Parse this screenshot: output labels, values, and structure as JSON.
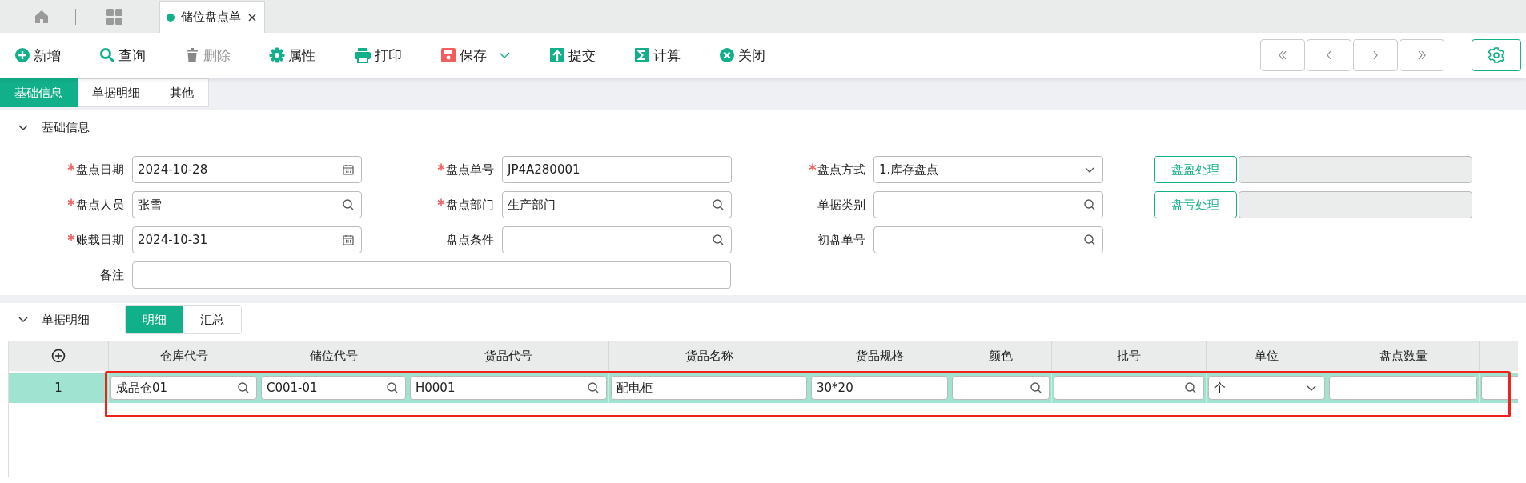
{
  "doc_tabs": [
    {
      "label": "储位盘点单",
      "selected": true,
      "closable": true
    }
  ],
  "toolbar": [
    {
      "kind": "add",
      "label": "新增",
      "disabled": false
    },
    {
      "kind": "search",
      "label": "查询",
      "disabled": false
    },
    {
      "kind": "delete",
      "label": "删除",
      "disabled": true
    },
    {
      "kind": "props",
      "label": "属性",
      "disabled": false
    },
    {
      "kind": "print",
      "label": "打印",
      "disabled": false
    },
    {
      "kind": "save",
      "label": "保存",
      "disabled": false,
      "has_menu": true
    },
    {
      "kind": "submit",
      "label": "提交",
      "disabled": false
    },
    {
      "kind": "calc",
      "label": "计算",
      "disabled": false
    },
    {
      "kind": "close",
      "label": "关闭",
      "disabled": false
    }
  ],
  "form_tabs": [
    {
      "label": "基础信息",
      "selected": true
    },
    {
      "label": "单据明细",
      "selected": false
    },
    {
      "label": "其他",
      "selected": false
    }
  ],
  "basic_section": {
    "title": "基础信息",
    "expanded": true,
    "rows": [
      [
        {
          "kind": "date",
          "label": "盘点日期",
          "required": true,
          "value": "2024-10-28"
        },
        {
          "kind": "text",
          "label": "盘点单号",
          "required": true,
          "value": "JP4A280001"
        },
        {
          "kind": "select",
          "label": "盘点方式",
          "required": true,
          "value": "1.库存盘点"
        },
        {
          "kind": "action",
          "label": "盘盈处理"
        }
      ],
      [
        {
          "kind": "lookup",
          "label": "盘点人员",
          "required": true,
          "value": "张雪"
        },
        {
          "kind": "lookup",
          "label": "盘点部门",
          "required": true,
          "value": "生产部门"
        },
        {
          "kind": "lookup",
          "label": "单据类别",
          "required": false
        },
        {
          "kind": "action",
          "label": "盘亏处理"
        }
      ],
      [
        {
          "kind": "date",
          "label": "账载日期",
          "required": true,
          "value": "2024-10-31"
        },
        {
          "kind": "lookup",
          "label": "盘点条件",
          "required": false
        },
        {
          "kind": "lookup",
          "label": "初盘单号",
          "required": false
        }
      ],
      [
        {
          "kind": "wide",
          "label": "备注",
          "required": false
        }
      ]
    ]
  },
  "detail_section": {
    "title": "单据明细",
    "expanded": true,
    "views": [
      {
        "label": "明细",
        "selected": true
      },
      {
        "label": "汇总",
        "selected": false
      }
    ]
  },
  "table": {
    "columns": [
      {
        "label": "仓库代号"
      },
      {
        "label": "储位代号"
      },
      {
        "label": "货品代号"
      },
      {
        "label": "货品名称"
      },
      {
        "label": "货品规格"
      },
      {
        "label": "颜色"
      },
      {
        "label": "批号"
      },
      {
        "label": "单位"
      },
      {
        "label": "盘点数量"
      },
      {
        "cut": true
      }
    ],
    "rows": [
      {
        "number": "1",
        "selected": true,
        "highlighted": true,
        "cells": [
          {
            "kind": "lookup",
            "value": "成品仓01"
          },
          {
            "kind": "lookup",
            "value": "C001-01"
          },
          {
            "kind": "lookup",
            "value": "H0001"
          },
          {
            "kind": "text",
            "value": "配电柜"
          },
          {
            "kind": "text",
            "value": "30*20"
          },
          {
            "kind": "lookup"
          },
          {
            "kind": "lookup"
          },
          {
            "kind": "select",
            "value": "个"
          },
          {
            "kind": "text"
          },
          {
            "kind": "text"
          }
        ]
      }
    ]
  }
}
